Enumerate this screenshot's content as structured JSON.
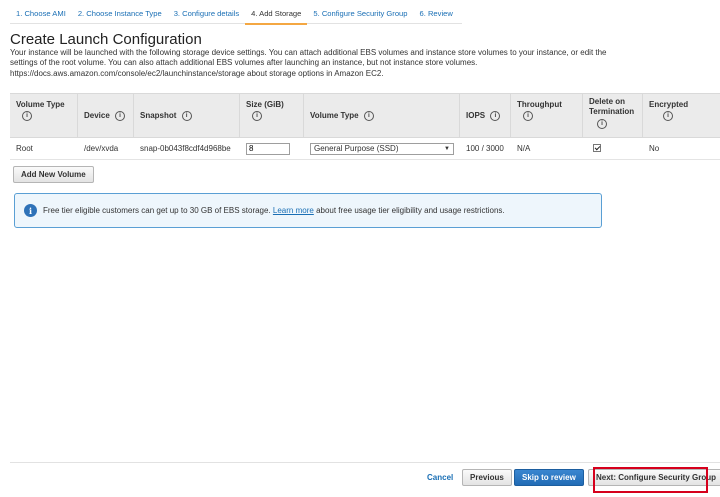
{
  "steps": [
    {
      "label": "1. Choose AMI"
    },
    {
      "label": "2. Choose Instance Type"
    },
    {
      "label": "3. Configure details"
    },
    {
      "label": "4. Add Storage"
    },
    {
      "label": "5. Configure Security Group"
    },
    {
      "label": "6. Review"
    }
  ],
  "page": {
    "title": "Create Launch Configuration",
    "intro": "Your instance will be launched with the following storage device settings. You can attach additional EBS volumes and instance store volumes to your instance, or edit the settings of the root volume. You can also attach additional EBS volumes after launching an instance, but not instance store volumes. https://docs.aws.amazon.com/console/ec2/launchinstance/storage about storage options in Amazon EC2."
  },
  "table": {
    "headers": {
      "volume_type": "Volume Type",
      "device": "Device",
      "snapshot": "Snapshot",
      "size": "Size (GiB)",
      "volume_type2": "Volume Type",
      "iops": "IOPS",
      "throughput": "Throughput",
      "delete_on_termination": "Delete on Termination",
      "encrypted": "Encrypted"
    },
    "row": {
      "volume_type": "Root",
      "device": "/dev/xvda",
      "snapshot": "snap-0b043f8cdf4d968be",
      "size": "8",
      "volume_type2": "General Purpose (SSD)",
      "iops": "100 / 3000",
      "throughput": "N/A",
      "delete_on_termination": true,
      "encrypted": "No"
    }
  },
  "buttons": {
    "add_volume": "Add New Volume",
    "cancel": "Cancel",
    "previous": "Previous",
    "skip_to_review": "Skip to review",
    "next": "Next: Configure Security Group"
  },
  "notice": {
    "text_before": "Free tier eligible customers can get up to 30 GB of EBS storage.",
    "link": "Learn more",
    "text_after": "about free usage tier eligibility and usage restrictions."
  },
  "icons": {
    "info": "i",
    "notice": "i"
  },
  "colors": {
    "link": "#1a6fb5",
    "active_step": "#f4a742",
    "primary_button": "#216bb5",
    "highlight": "#d6001c"
  }
}
